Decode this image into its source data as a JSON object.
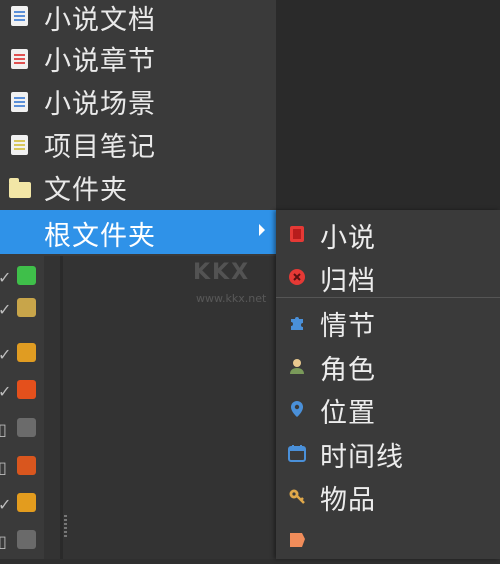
{
  "main_menu": {
    "items": [
      {
        "label": "小说文档",
        "icon": "novel-doc-icon"
      },
      {
        "label": "小说章节",
        "icon": "chapter-doc-icon"
      },
      {
        "label": "小说场景",
        "icon": "scene-doc-icon"
      },
      {
        "label": "项目笔记",
        "icon": "notes-doc-icon"
      },
      {
        "label": "文件夹",
        "icon": "folder-icon"
      },
      {
        "label": "根文件夹",
        "icon": "submenu-arrow-icon"
      }
    ],
    "active_index": 5
  },
  "submenu": {
    "items": [
      {
        "label": "小说",
        "icon": "novel-icon",
        "color": "#e53935"
      },
      {
        "label": "归档",
        "icon": "archive-icon",
        "color": "#e53935"
      },
      {
        "label": "情节",
        "icon": "plot-icon",
        "color": "#4a90d9"
      },
      {
        "label": "角色",
        "icon": "character-icon",
        "color": "#e9c98f"
      },
      {
        "label": "位置",
        "icon": "location-icon",
        "color": "#4a90d9"
      },
      {
        "label": "时间线",
        "icon": "timeline-icon",
        "color": "#4a90d9"
      },
      {
        "label": "物品",
        "icon": "item-icon",
        "color": "#e0a84a"
      },
      {
        "label": "",
        "icon": "partial-icon",
        "color": "#f08c5a"
      }
    ]
  },
  "status_swatches": [
    "#3fbf4a",
    "#c8a54a",
    "#e09c22",
    "#e4501c",
    "#6b6b6b",
    "#d9561e",
    "#e39c1e",
    "#6a6a6a"
  ],
  "watermark": {
    "brand": "KKX",
    "url": "www.kkx.net"
  }
}
